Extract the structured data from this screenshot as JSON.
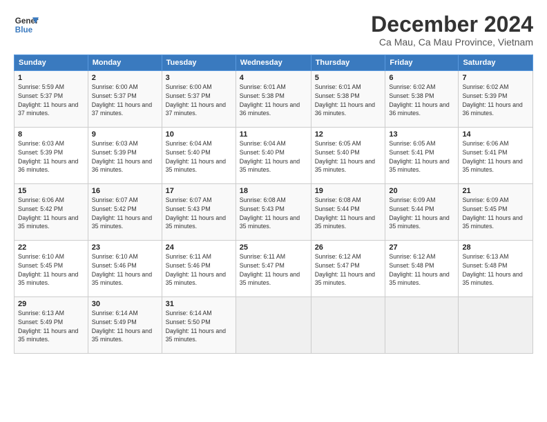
{
  "header": {
    "logo_line1": "General",
    "logo_line2": "Blue",
    "main_title": "December 2024",
    "subtitle": "Ca Mau, Ca Mau Province, Vietnam"
  },
  "calendar": {
    "days_of_week": [
      "Sunday",
      "Monday",
      "Tuesday",
      "Wednesday",
      "Thursday",
      "Friday",
      "Saturday"
    ],
    "weeks": [
      [
        {
          "day": "",
          "empty": true
        },
        {
          "day": "",
          "empty": true
        },
        {
          "day": "",
          "empty": true
        },
        {
          "day": "",
          "empty": true
        },
        {
          "day": "",
          "empty": true
        },
        {
          "day": "",
          "empty": true
        },
        {
          "day": "",
          "empty": true
        }
      ],
      [
        {
          "num": "1",
          "sunrise": "5:59 AM",
          "sunset": "5:37 PM",
          "daylight": "11 hours and 37 minutes."
        },
        {
          "num": "2",
          "sunrise": "6:00 AM",
          "sunset": "5:37 PM",
          "daylight": "11 hours and 37 minutes."
        },
        {
          "num": "3",
          "sunrise": "6:00 AM",
          "sunset": "5:37 PM",
          "daylight": "11 hours and 37 minutes."
        },
        {
          "num": "4",
          "sunrise": "6:01 AM",
          "sunset": "5:38 PM",
          "daylight": "11 hours and 36 minutes."
        },
        {
          "num": "5",
          "sunrise": "6:01 AM",
          "sunset": "5:38 PM",
          "daylight": "11 hours and 36 minutes."
        },
        {
          "num": "6",
          "sunrise": "6:02 AM",
          "sunset": "5:38 PM",
          "daylight": "11 hours and 36 minutes."
        },
        {
          "num": "7",
          "sunrise": "6:02 AM",
          "sunset": "5:39 PM",
          "daylight": "11 hours and 36 minutes."
        }
      ],
      [
        {
          "num": "8",
          "sunrise": "6:03 AM",
          "sunset": "5:39 PM",
          "daylight": "11 hours and 36 minutes."
        },
        {
          "num": "9",
          "sunrise": "6:03 AM",
          "sunset": "5:39 PM",
          "daylight": "11 hours and 36 minutes."
        },
        {
          "num": "10",
          "sunrise": "6:04 AM",
          "sunset": "5:40 PM",
          "daylight": "11 hours and 35 minutes."
        },
        {
          "num": "11",
          "sunrise": "6:04 AM",
          "sunset": "5:40 PM",
          "daylight": "11 hours and 35 minutes."
        },
        {
          "num": "12",
          "sunrise": "6:05 AM",
          "sunset": "5:40 PM",
          "daylight": "11 hours and 35 minutes."
        },
        {
          "num": "13",
          "sunrise": "6:05 AM",
          "sunset": "5:41 PM",
          "daylight": "11 hours and 35 minutes."
        },
        {
          "num": "14",
          "sunrise": "6:06 AM",
          "sunset": "5:41 PM",
          "daylight": "11 hours and 35 minutes."
        }
      ],
      [
        {
          "num": "15",
          "sunrise": "6:06 AM",
          "sunset": "5:42 PM",
          "daylight": "11 hours and 35 minutes."
        },
        {
          "num": "16",
          "sunrise": "6:07 AM",
          "sunset": "5:42 PM",
          "daylight": "11 hours and 35 minutes."
        },
        {
          "num": "17",
          "sunrise": "6:07 AM",
          "sunset": "5:43 PM",
          "daylight": "11 hours and 35 minutes."
        },
        {
          "num": "18",
          "sunrise": "6:08 AM",
          "sunset": "5:43 PM",
          "daylight": "11 hours and 35 minutes."
        },
        {
          "num": "19",
          "sunrise": "6:08 AM",
          "sunset": "5:44 PM",
          "daylight": "11 hours and 35 minutes."
        },
        {
          "num": "20",
          "sunrise": "6:09 AM",
          "sunset": "5:44 PM",
          "daylight": "11 hours and 35 minutes."
        },
        {
          "num": "21",
          "sunrise": "6:09 AM",
          "sunset": "5:45 PM",
          "daylight": "11 hours and 35 minutes."
        }
      ],
      [
        {
          "num": "22",
          "sunrise": "6:10 AM",
          "sunset": "5:45 PM",
          "daylight": "11 hours and 35 minutes."
        },
        {
          "num": "23",
          "sunrise": "6:10 AM",
          "sunset": "5:46 PM",
          "daylight": "11 hours and 35 minutes."
        },
        {
          "num": "24",
          "sunrise": "6:11 AM",
          "sunset": "5:46 PM",
          "daylight": "11 hours and 35 minutes."
        },
        {
          "num": "25",
          "sunrise": "6:11 AM",
          "sunset": "5:47 PM",
          "daylight": "11 hours and 35 minutes."
        },
        {
          "num": "26",
          "sunrise": "6:12 AM",
          "sunset": "5:47 PM",
          "daylight": "11 hours and 35 minutes."
        },
        {
          "num": "27",
          "sunrise": "6:12 AM",
          "sunset": "5:48 PM",
          "daylight": "11 hours and 35 minutes."
        },
        {
          "num": "28",
          "sunrise": "6:13 AM",
          "sunset": "5:48 PM",
          "daylight": "11 hours and 35 minutes."
        }
      ],
      [
        {
          "num": "29",
          "sunrise": "6:13 AM",
          "sunset": "5:49 PM",
          "daylight": "11 hours and 35 minutes."
        },
        {
          "num": "30",
          "sunrise": "6:14 AM",
          "sunset": "5:49 PM",
          "daylight": "11 hours and 35 minutes."
        },
        {
          "num": "31",
          "sunrise": "6:14 AM",
          "sunset": "5:50 PM",
          "daylight": "11 hours and 35 minutes."
        },
        {
          "day": "",
          "empty": true
        },
        {
          "day": "",
          "empty": true
        },
        {
          "day": "",
          "empty": true
        },
        {
          "day": "",
          "empty": true
        }
      ]
    ]
  }
}
